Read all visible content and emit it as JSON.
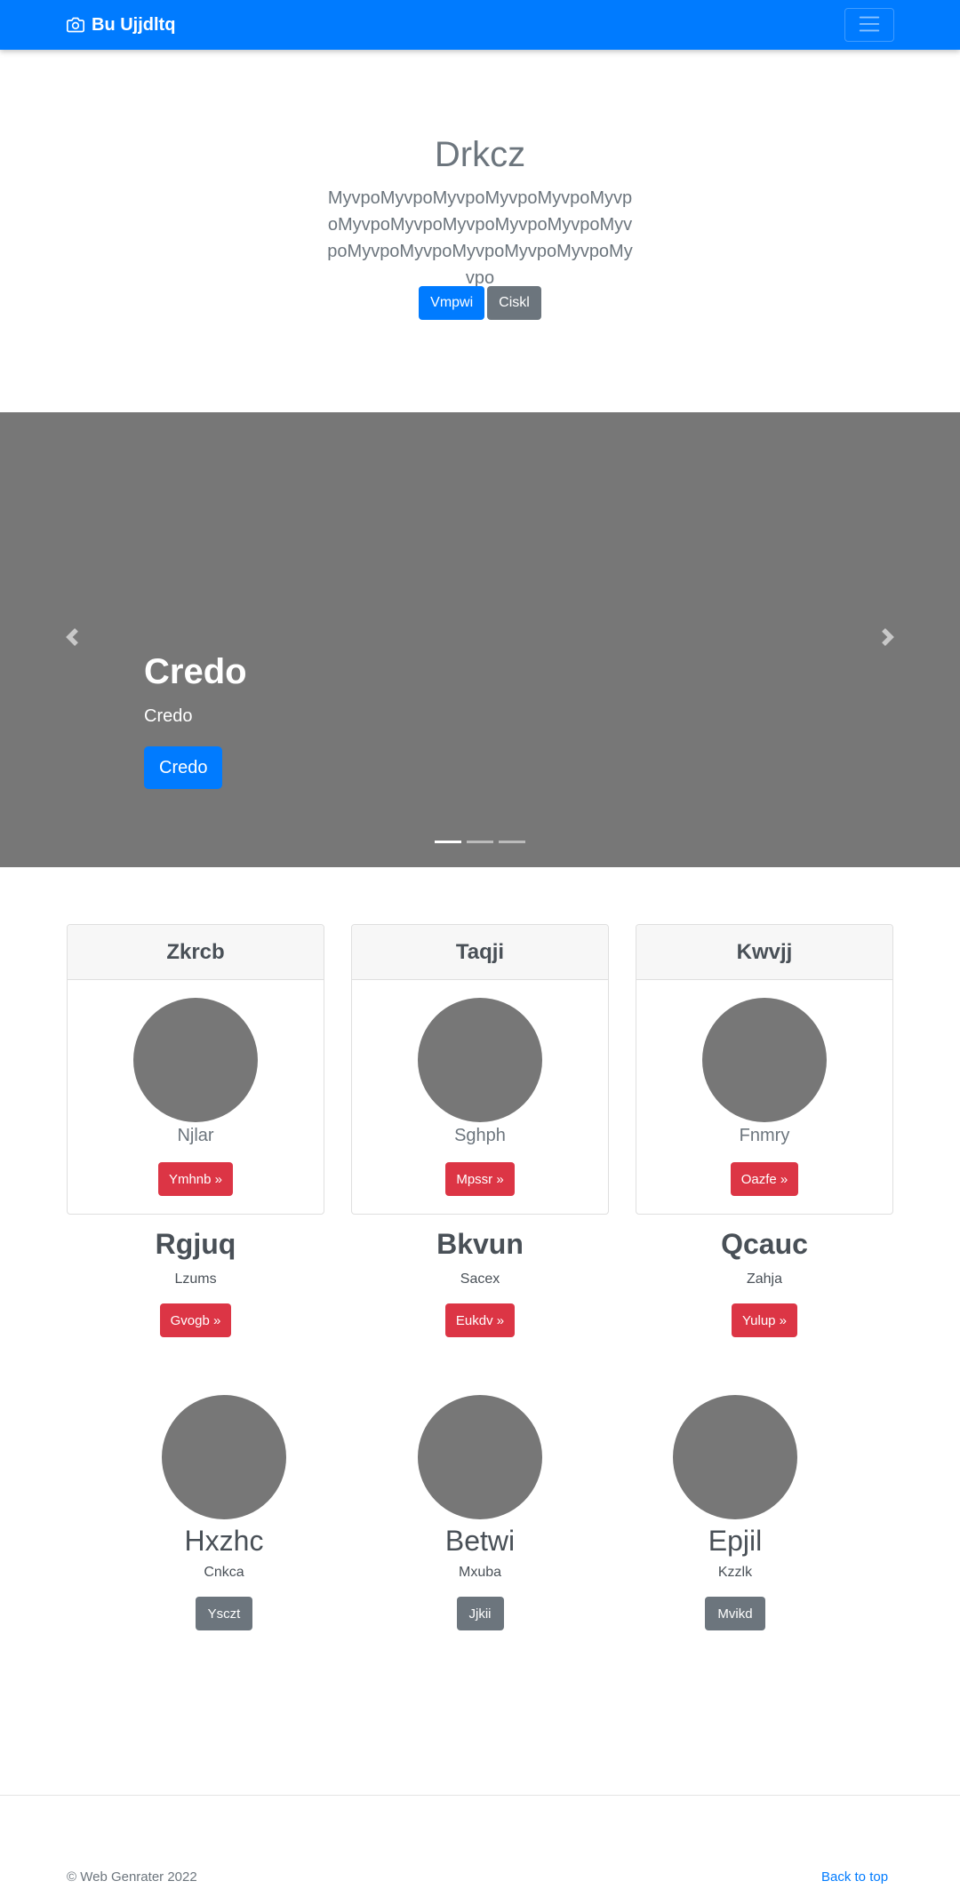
{
  "navbar": {
    "brand": "Bu Ujjdltq",
    "brand_icon": "camera-icon",
    "toggler_icon": "hamburger-icon"
  },
  "hero": {
    "title": "Drkcz",
    "lead": "MyvpoMyvpoMyvpoMyvpoMyvpoMyvpoMyvpoMyvpoMyvpoMyvpoMyvpoMyvpoMyvpoMyvpoMyvpoMyvpoMyvpoMyvpo",
    "primary_button": "Vmpwi",
    "secondary_button": "Ciskl"
  },
  "carousel": {
    "heading": "Credo",
    "text": "Credo",
    "button": "Credo",
    "prev_icon": "chevron-left-icon",
    "next_icon": "chevron-right-icon",
    "slides": 3,
    "active_slide": 1,
    "background": "#777777"
  },
  "cards": [
    {
      "header": "Zkrcb",
      "subtitle": "Njlar",
      "button": "Ymhnb »"
    },
    {
      "header": "Taqji",
      "subtitle": "Sghph",
      "button": "Mpssr »"
    },
    {
      "header": "Kwvjj",
      "subtitle": "Fnmry",
      "button": "Oazfe »"
    }
  ],
  "features": [
    {
      "title": "Rgjuq",
      "text": "Lzums",
      "button": "Gvogb »"
    },
    {
      "title": "Bkvun",
      "text": "Sacex",
      "button": "Eukdv »"
    },
    {
      "title": "Qcauc",
      "text": "Zahja",
      "button": "Yulup »"
    }
  ],
  "marketing": [
    {
      "title": "Hxzhc",
      "text": "Cnkca",
      "button": "Ysczt"
    },
    {
      "title": "Betwi",
      "text": "Mxuba",
      "button": "Jjkii"
    },
    {
      "title": "Epjil",
      "text": "Kzzlk",
      "button": "Mvikd"
    }
  ],
  "footer": {
    "copyright": "© Web Genrater 2022",
    "back_to_top": "Back to top"
  },
  "colors": {
    "primary": "#007bff",
    "secondary": "#6c757d",
    "danger": "#dc3545",
    "placeholder": "#777777"
  }
}
